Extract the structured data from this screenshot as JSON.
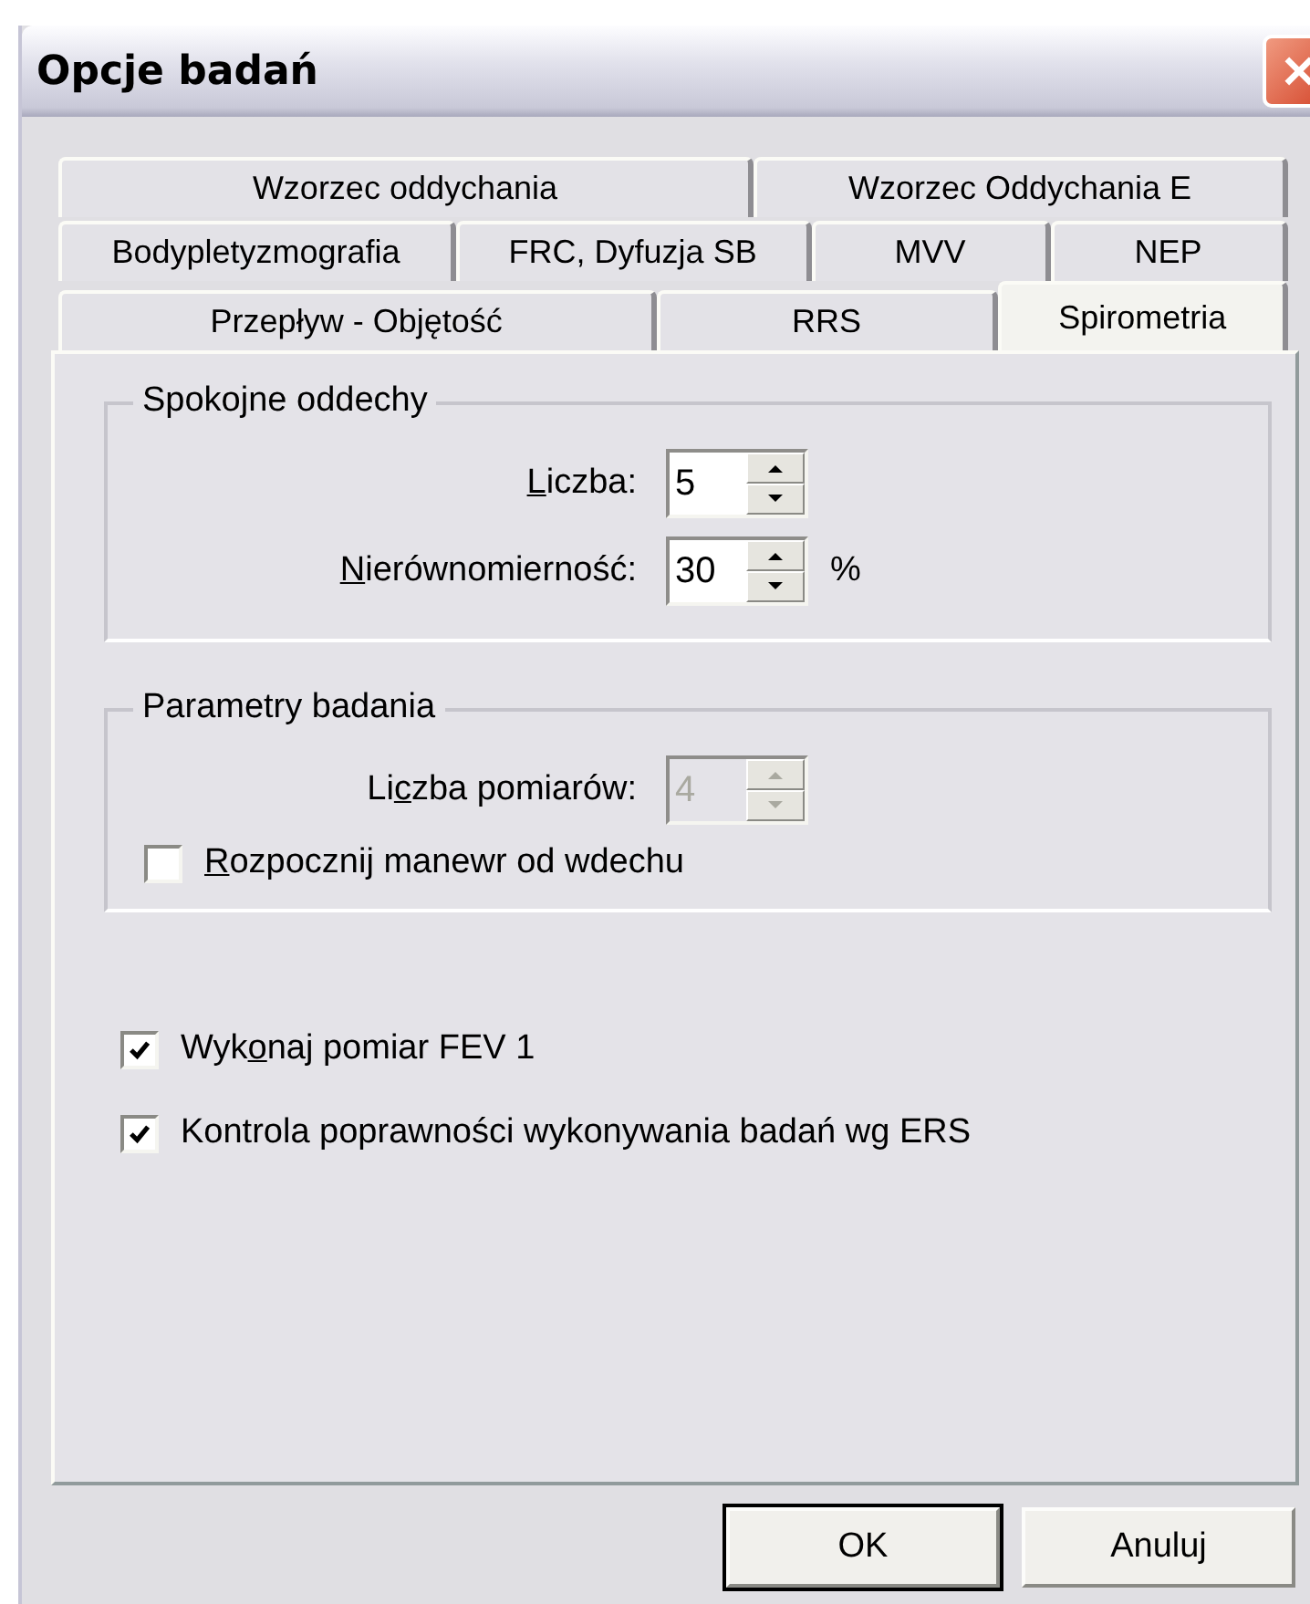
{
  "window": {
    "title": "Opcje badań"
  },
  "tab_rows": [
    [
      {
        "label": "Wzorzec oddychania",
        "selected": false
      },
      {
        "label": "Wzorzec Oddychania E",
        "selected": false
      }
    ],
    [
      {
        "label": "Bodypletyzmografia",
        "selected": false
      },
      {
        "label": "FRC, Dyfuzja SB",
        "selected": false
      },
      {
        "label": "MVV",
        "selected": false
      },
      {
        "label": "NEP",
        "selected": false
      }
    ],
    [
      {
        "label": "Przepływ - Objętość",
        "selected": false
      },
      {
        "label": "RRS",
        "selected": false
      },
      {
        "label": "Spirometria",
        "selected": true
      }
    ]
  ],
  "groups": [
    {
      "title": "Spokojne oddechy",
      "items": [
        {
          "kind": "spin",
          "access_key": "L",
          "label_end": "iczba:",
          "value": "5",
          "disabled": false
        },
        {
          "kind": "spin",
          "access_key": "N",
          "label_end": "ierównomierność:",
          "value": "30",
          "disabled": false,
          "unit": "%"
        }
      ]
    },
    {
      "title": "Parametry badania",
      "items": [
        {
          "kind": "spin",
          "label_start": "Li",
          "access_key": "c",
          "label_end": "zba pomiarów:",
          "value": "4",
          "disabled": true
        },
        {
          "kind": "check",
          "access_key": "R",
          "label_end": "ozpocznij manewr od wdechu",
          "checked": false
        }
      ]
    }
  ],
  "checks": [
    {
      "label_start": "Wyk",
      "access_key": "o",
      "label_end": "naj pomiar FEV 1",
      "checked": true
    },
    {
      "label": "Kontrola poprawności wykonywania badań wg ERS",
      "checked": true
    }
  ],
  "buttons": [
    {
      "label": "OK",
      "default": true
    },
    {
      "label": "Anuluj",
      "default": false
    }
  ]
}
